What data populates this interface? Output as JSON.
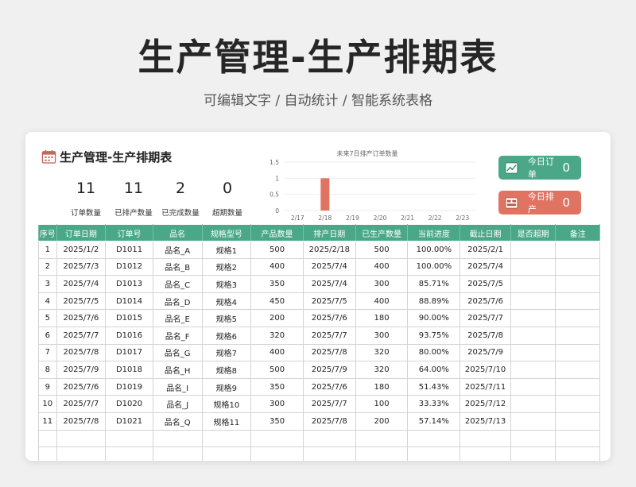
{
  "page": {
    "title": "生产管理-生产排期表",
    "subtitle": "可编辑文字 / 自动统计 / 智能系统表格"
  },
  "sheet": {
    "title": "生产管理-生产排期表",
    "stats": [
      {
        "value": "11",
        "label": "订单数量"
      },
      {
        "value": "11",
        "label": "已排产数量"
      },
      {
        "value": "2",
        "label": "已完成数量"
      },
      {
        "value": "0",
        "label": "超期数量"
      }
    ],
    "today_orders": {
      "label": "今日订单",
      "value": "0",
      "color": "#4aa787"
    },
    "today_schedule": {
      "label": "今日排产",
      "value": "0",
      "color": "#e07362"
    }
  },
  "chart_data": {
    "type": "bar",
    "title": "未来7日排产订单数量",
    "categories": [
      "2/17",
      "2/18",
      "2/19",
      "2/20",
      "2/21",
      "2/22",
      "2/23"
    ],
    "values": [
      0,
      1,
      0,
      0,
      0,
      0,
      0
    ],
    "y_ticks": [
      "0",
      "0.5",
      "1",
      "1.5"
    ],
    "ylim": [
      0,
      1.5
    ],
    "bar_color": "#e07362",
    "grid": true
  },
  "table": {
    "headers": [
      "序号",
      "订单日期",
      "订单号",
      "品名",
      "规格型号",
      "产品数量",
      "排产日期",
      "已生产数量",
      "当前进度",
      "截止日期",
      "是否超期",
      "备注"
    ],
    "rows": [
      [
        "1",
        "2025/1/2",
        "D1011",
        "品名_A",
        "规格1",
        "500",
        "2025/2/18",
        "500",
        "100.00%",
        "2025/2/1",
        "",
        ""
      ],
      [
        "2",
        "2025/7/3",
        "D1012",
        "品名_B",
        "规格2",
        "400",
        "2025/7/4",
        "400",
        "100.00%",
        "2025/7/4",
        "",
        ""
      ],
      [
        "3",
        "2025/7/4",
        "D1013",
        "品名_C",
        "规格3",
        "350",
        "2025/7/4",
        "300",
        "85.71%",
        "2025/7/5",
        "",
        ""
      ],
      [
        "4",
        "2025/7/5",
        "D1014",
        "品名_D",
        "规格4",
        "450",
        "2025/7/5",
        "400",
        "88.89%",
        "2025/7/6",
        "",
        ""
      ],
      [
        "5",
        "2025/7/6",
        "D1015",
        "品名_E",
        "规格5",
        "200",
        "2025/7/6",
        "180",
        "90.00%",
        "2025/7/7",
        "",
        ""
      ],
      [
        "6",
        "2025/7/7",
        "D1016",
        "品名_F",
        "规格6",
        "320",
        "2025/7/7",
        "300",
        "93.75%",
        "2025/7/8",
        "",
        ""
      ],
      [
        "7",
        "2025/7/8",
        "D1017",
        "品名_G",
        "规格7",
        "400",
        "2025/7/8",
        "320",
        "80.00%",
        "2025/7/9",
        "",
        ""
      ],
      [
        "8",
        "2025/7/9",
        "D1018",
        "品名_H",
        "规格8",
        "500",
        "2025/7/9",
        "320",
        "64.00%",
        "2025/7/10",
        "",
        ""
      ],
      [
        "9",
        "2025/7/6",
        "D1019",
        "品名_I",
        "规格9",
        "350",
        "2025/7/6",
        "180",
        "51.43%",
        "2025/7/11",
        "",
        ""
      ],
      [
        "10",
        "2025/7/7",
        "D1020",
        "品名_J",
        "规格10",
        "300",
        "2025/7/7",
        "100",
        "33.33%",
        "2025/7/12",
        "",
        ""
      ],
      [
        "11",
        "2025/7/8",
        "D1021",
        "品名_Q",
        "规格11",
        "350",
        "2025/7/8",
        "200",
        "57.14%",
        "2025/7/13",
        "",
        ""
      ],
      [
        "",
        "",
        "",
        "",
        "",
        "",
        "",
        "",
        "",
        "",
        "",
        ""
      ],
      [
        "",
        "",
        "",
        "",
        "",
        "",
        "",
        "",
        "",
        "",
        "",
        ""
      ]
    ]
  }
}
